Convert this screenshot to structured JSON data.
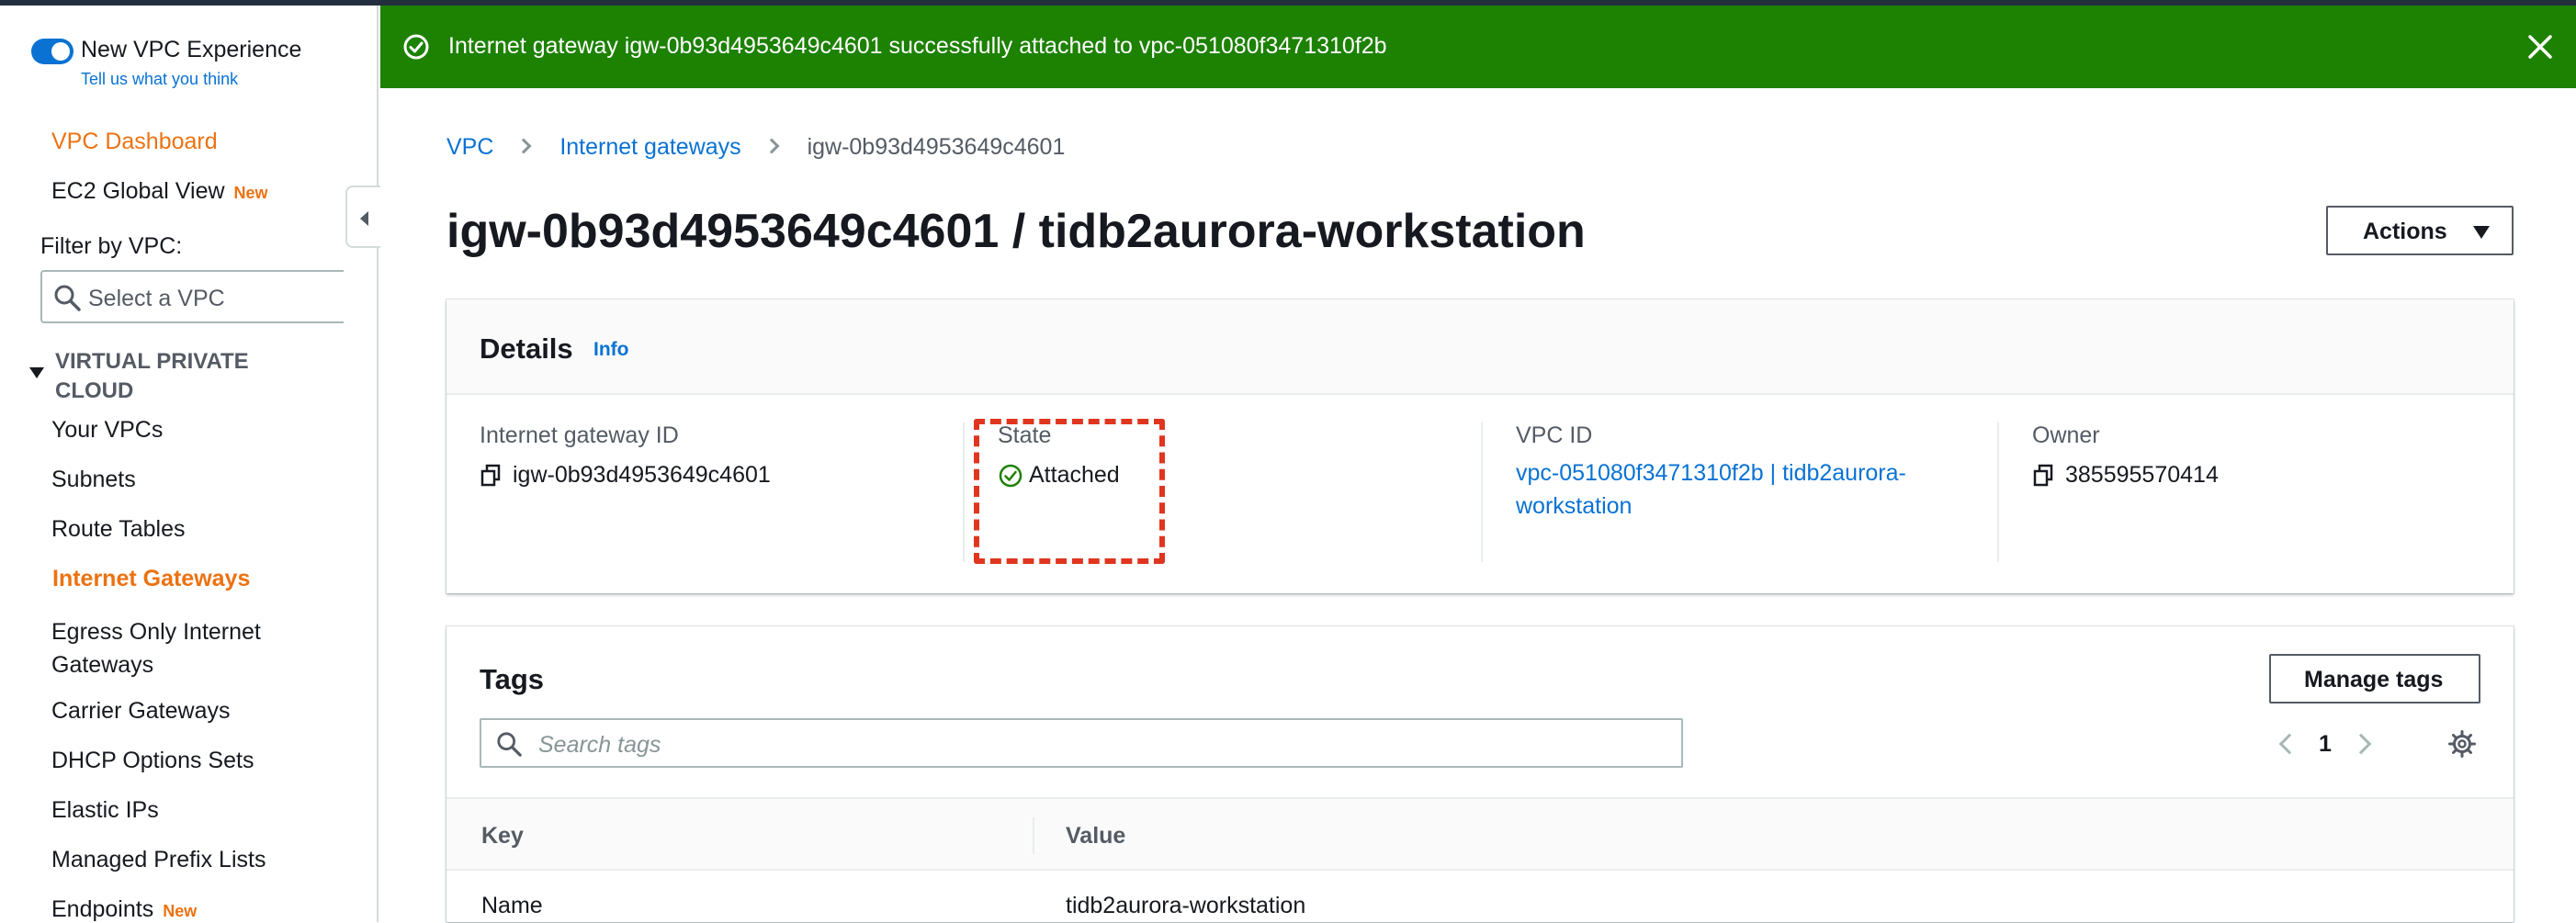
{
  "sidebar": {
    "experience_title": "New VPC Experience",
    "experience_link": "Tell us what you think",
    "dashboard": "VPC Dashboard",
    "ec2_global_view": "EC2 Global View",
    "new_badge": "New",
    "filter_label": "Filter by VPC:",
    "filter_placeholder": "Select a VPC",
    "section_title": "VIRTUAL PRIVATE CLOUD",
    "items": [
      {
        "label": "Your VPCs"
      },
      {
        "label": "Subnets"
      },
      {
        "label": "Route Tables"
      },
      {
        "label": "Internet Gateways",
        "active": true
      },
      {
        "label": "Egress Only Internet Gateways"
      },
      {
        "label": "Carrier Gateways"
      },
      {
        "label": "DHCP Options Sets"
      },
      {
        "label": "Elastic IPs"
      },
      {
        "label": "Managed Prefix Lists"
      },
      {
        "label": "Endpoints",
        "badge": "New"
      }
    ]
  },
  "flash": {
    "message": "Internet gateway igw-0b93d4953649c4601 successfully attached to vpc-051080f3471310f2b",
    "color": "#1d8102"
  },
  "breadcrumb": {
    "items": [
      "VPC",
      "Internet gateways"
    ],
    "current": "igw-0b93d4953649c4601"
  },
  "page": {
    "title": "igw-0b93d4953649c4601 / tidb2aurora-workstation",
    "actions_label": "Actions"
  },
  "details": {
    "title": "Details",
    "info_label": "Info",
    "gateway_id_label": "Internet gateway ID",
    "gateway_id": "igw-0b93d4953649c4601",
    "state_label": "State",
    "state": "Attached",
    "vpc_id_label": "VPC ID",
    "vpc_id_line1": "vpc-051080f3471310f2b | tidb2aurora-",
    "vpc_id_line2": "workstation",
    "owner_label": "Owner",
    "owner": "385595570414"
  },
  "tags": {
    "title": "Tags",
    "manage_label": "Manage tags",
    "search_placeholder": "Search tags",
    "page_number": "1",
    "columns": [
      "Key",
      "Value"
    ],
    "rows": [
      {
        "key": "Name",
        "value": "tidb2aurora-workstation"
      }
    ]
  },
  "colors": {
    "accent": "#0972d3",
    "active_nav": "#ec7211",
    "success": "#1d8102",
    "highlight": "#e0351f"
  }
}
